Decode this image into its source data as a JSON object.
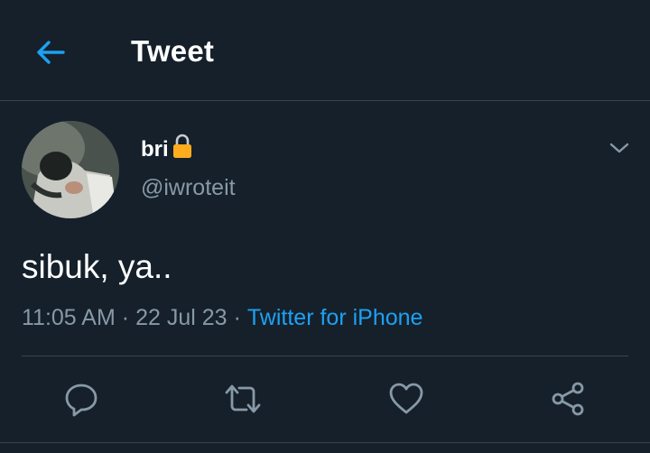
{
  "header": {
    "title": "Tweet",
    "back_icon": "arrow-left-icon"
  },
  "tweet": {
    "author": {
      "display_name": "bri",
      "handle": "@iwroteit",
      "protected": true,
      "lock_icon": "lock-icon"
    },
    "text": "sibuk, ya..",
    "time": "11:05 AM",
    "date": "22 Jul 23",
    "separator": "·",
    "source": "Twitter for iPhone",
    "menu_icon": "chevron-down-icon"
  },
  "actions": [
    {
      "name": "reply",
      "icon": "reply-icon"
    },
    {
      "name": "retweet",
      "icon": "retweet-icon"
    },
    {
      "name": "like",
      "icon": "heart-icon"
    },
    {
      "name": "share",
      "icon": "share-icon"
    }
  ],
  "colors": {
    "background": "#15202b",
    "accent": "#1da1f2",
    "secondary_text": "#8899a6",
    "divider": "#38444d",
    "lock": "#ffad1f"
  }
}
